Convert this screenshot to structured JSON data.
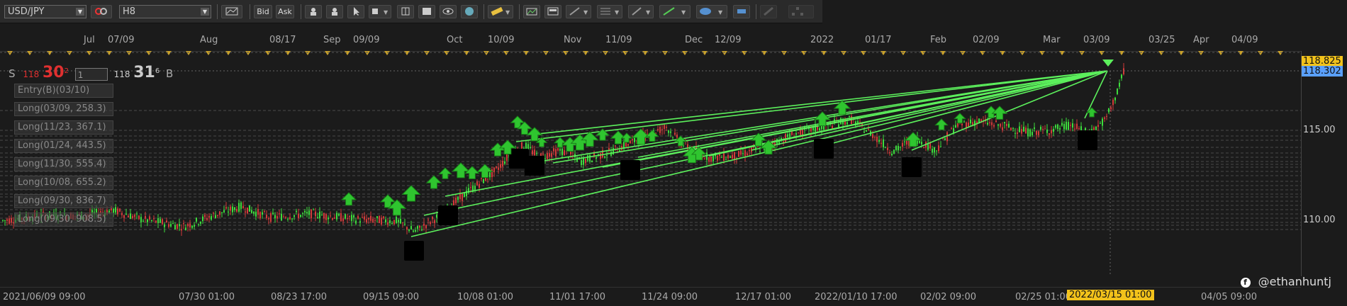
{
  "toolbar": {
    "symbol": "USD/JPY",
    "timeframe": "H8",
    "bid_label": "Bid",
    "ask_label": "Ask"
  },
  "top_axis": [
    "Jul",
    "07/09",
    "Aug",
    "08/17",
    "Sep",
    "09/09",
    "Oct",
    "10/09",
    "Nov",
    "11/09",
    "Dec",
    "12/09",
    "2022",
    "01/17",
    "Feb",
    "02/09",
    "Mar",
    "03/09",
    "03/25",
    "Apr",
    "04/09"
  ],
  "price_axis": [
    "115.00",
    "110.00"
  ],
  "price_tags": {
    "ask": "118.825",
    "bid": "118.302"
  },
  "quote": {
    "sell_label": "S",
    "sell_big": "118",
    "sell_pips": "30",
    "sell_sup": "2",
    "lot": "1",
    "buy_big": "118",
    "buy_pips": "31",
    "buy_sup": "6",
    "buy_label": "B"
  },
  "orders": [
    "Entry(B)(03/10)",
    "Long(03/09, 258.3)",
    "Long(11/23, 367.1)",
    "Long(01/24, 443.5)",
    "Long(11/30, 555.4)",
    "Long(10/08, 655.2)",
    "Long(09/30, 836.7)",
    "Long(09/30, 908.5)"
  ],
  "bottom_axis": [
    "2021/06/09 09:00",
    "07/30 01:00",
    "08/23 17:00",
    "09/15 09:00",
    "10/08 01:00",
    "11/01 17:00",
    "11/24 09:00",
    "12/17 01:00",
    "2022/01/10 17:00",
    "02/02 09:00",
    "02/25 01:00",
    "2022/03/15 01:00",
    "04/05 09:00"
  ],
  "watermark": "@ethanhuntj",
  "colors": {
    "bull": "#3ddc3d",
    "bear": "#d23a3a",
    "line": "#5cf05c",
    "ask_tag": "#f2c21b",
    "bid_tag": "#5aa0ff",
    "cursor_tag": "#f2c21b"
  }
}
